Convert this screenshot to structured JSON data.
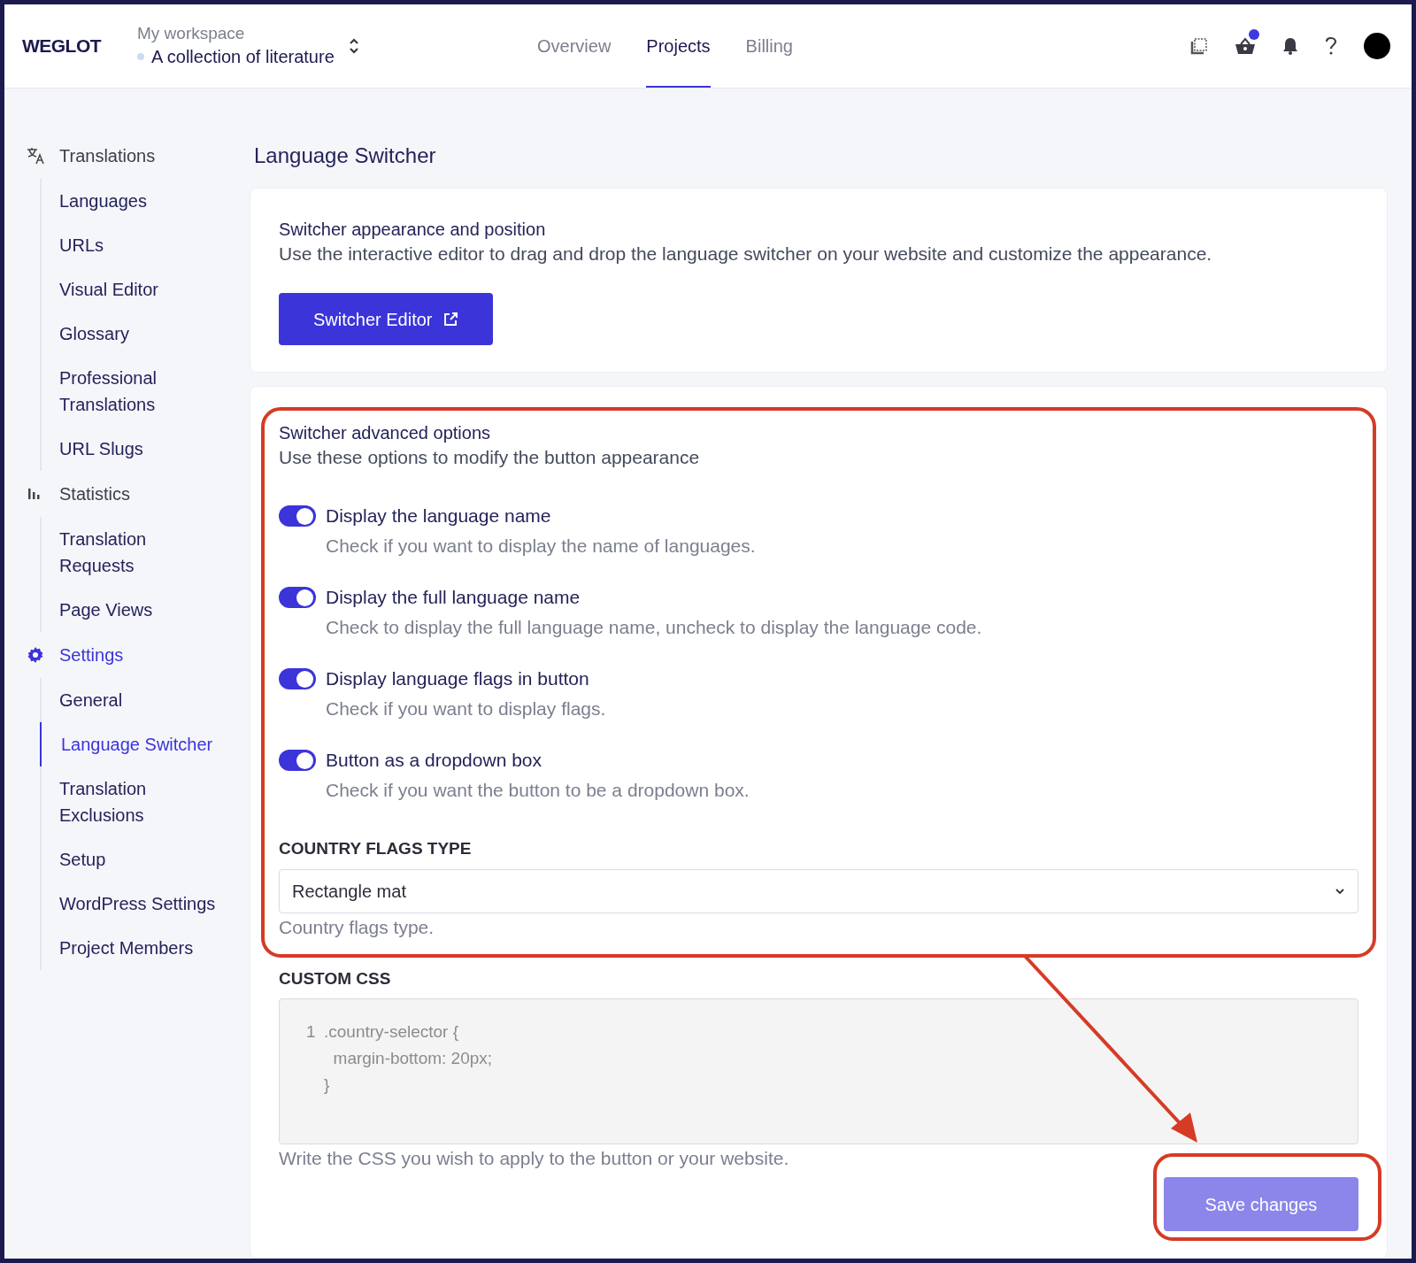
{
  "header": {
    "logo": "WEGLOT",
    "workspace": "My workspace",
    "project": "A collection of literature",
    "tabs": [
      {
        "label": "Overview",
        "selected": false
      },
      {
        "label": "Projects",
        "selected": true
      },
      {
        "label": "Billing",
        "selected": false
      }
    ],
    "cart_badge": true
  },
  "sidebar": {
    "sections": [
      {
        "label": "Translations",
        "selected": false,
        "children": [
          {
            "label": "Languages",
            "selected": false
          },
          {
            "label": "URLs",
            "selected": false
          },
          {
            "label": "Visual Editor",
            "selected": false
          },
          {
            "label": "Glossary",
            "selected": false
          },
          {
            "label": "Professional Translations",
            "selected": false
          },
          {
            "label": "URL Slugs",
            "selected": false
          }
        ]
      },
      {
        "label": "Statistics",
        "selected": false,
        "children": [
          {
            "label": "Translation Requests",
            "selected": false
          },
          {
            "label": "Page Views",
            "selected": false
          }
        ]
      },
      {
        "label": "Settings",
        "selected": true,
        "children": [
          {
            "label": "General",
            "selected": false
          },
          {
            "label": "Language Switcher",
            "selected": true
          },
          {
            "label": "Translation Exclusions",
            "selected": false
          },
          {
            "label": "Setup",
            "selected": false
          },
          {
            "label": "WordPress Settings",
            "selected": false
          },
          {
            "label": "Project Members",
            "selected": false
          }
        ]
      }
    ]
  },
  "page": {
    "title": "Language Switcher",
    "appearance": {
      "title": "Switcher appearance and position",
      "description": "Use the interactive editor to drag and drop the language switcher on your website and customize the appearance.",
      "button": "Switcher Editor"
    },
    "advanced": {
      "title": "Switcher advanced options",
      "description": "Use these options to modify the button appearance",
      "toggles": [
        {
          "label": "Display the language name",
          "hint": "Check if you want to display the name of languages.",
          "on": true
        },
        {
          "label": "Display the full language name",
          "hint": "Check to display the full language name, uncheck to display the language code.",
          "on": true
        },
        {
          "label": "Display language flags in button",
          "hint": "Check if you want to display flags.",
          "on": true
        },
        {
          "label": "Button as a dropdown box",
          "hint": "Check if you want the button to be a dropdown box.",
          "on": true
        }
      ],
      "flags_type": {
        "label": "COUNTRY FLAGS TYPE",
        "value": "Rectangle mat",
        "hint": "Country flags type."
      },
      "custom_css": {
        "label": "CUSTOM CSS",
        "lines": [
          {
            "number": "1",
            "text": ".country-selector {"
          },
          {
            "text": "  margin-bottom: 20px;"
          },
          {
            "text": "}"
          }
        ],
        "hint": "Write the CSS you wish to apply to the button or your website."
      },
      "save": {
        "label": "Save changes",
        "disabled": true
      }
    }
  }
}
